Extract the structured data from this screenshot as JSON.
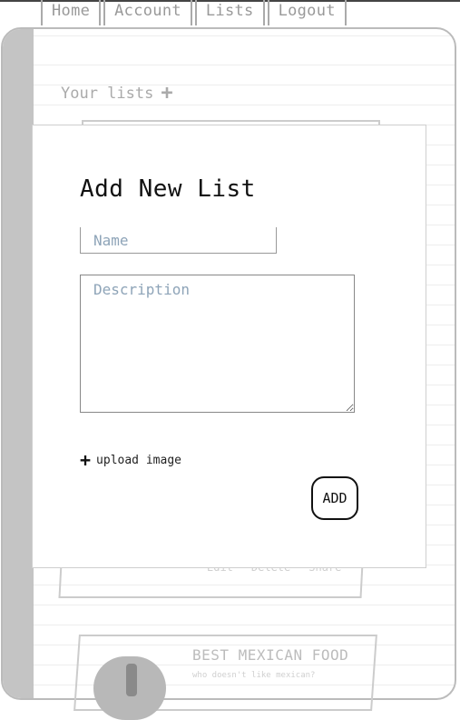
{
  "nav": {
    "items": [
      {
        "label": "Home"
      },
      {
        "label": "Account"
      },
      {
        "label": "Lists"
      },
      {
        "label": "Logout"
      }
    ]
  },
  "page": {
    "heading": "Your lists",
    "add_icon": "plus-icon"
  },
  "background_cards": [
    {
      "actions": [
        "Edit",
        "Delete",
        "Share"
      ]
    },
    {
      "title": "BEST MEXICAN FOOD",
      "description": "who doesn't like mexican?"
    }
  ],
  "modal": {
    "title": "Add New List",
    "name": {
      "value": "",
      "placeholder": "Name"
    },
    "description": {
      "value": "",
      "placeholder": "Description"
    },
    "upload_label": "upload image",
    "add_button": "ADD"
  },
  "colors": {
    "placeholder": "#8ea4b8",
    "frame_left": "#c4c4c4",
    "muted_text": "#aaaaaa"
  }
}
